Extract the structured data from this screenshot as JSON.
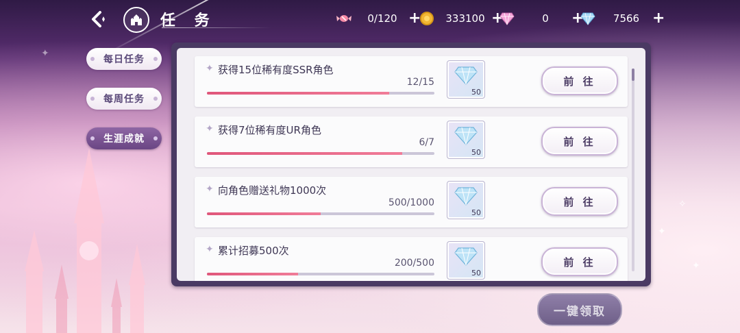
{
  "header": {
    "title": "任 务",
    "back_icon": "back-arrow-icon",
    "home_icon": "castle-icon"
  },
  "resources": [
    {
      "name": "candy",
      "icon": "candy-icon",
      "value": "0/120"
    },
    {
      "name": "coin",
      "icon": "coin-icon",
      "value": "333100"
    },
    {
      "name": "pink-gem",
      "icon": "pink-diamond-icon",
      "value": "0"
    },
    {
      "name": "blue-gem",
      "icon": "blue-diamond-icon",
      "value": "7566"
    }
  ],
  "plus_label": "+",
  "tabs": [
    {
      "label": "每日任务",
      "active": false
    },
    {
      "label": "每周任务",
      "active": false
    },
    {
      "label": "生涯成就",
      "active": true
    }
  ],
  "tasks": [
    {
      "title": "获得15位稀有度SSR角色",
      "progress_text": "12/15",
      "progress": 0.8,
      "reward_icon": "diamond-icon",
      "reward_qty": "50",
      "button": "前 往"
    },
    {
      "title": "获得7位稀有度UR角色",
      "progress_text": "6/7",
      "progress": 0.857,
      "reward_icon": "diamond-icon",
      "reward_qty": "50",
      "button": "前 往"
    },
    {
      "title": "向角色赠送礼物1000次",
      "progress_text": "500/1000",
      "progress": 0.5,
      "reward_icon": "diamond-icon",
      "reward_qty": "50",
      "button": "前 往"
    },
    {
      "title": "累计招募500次",
      "progress_text": "200/500",
      "progress": 0.4,
      "reward_icon": "diamond-icon",
      "reward_qty": "50",
      "button": "前 往"
    }
  ],
  "claim_all": "一键领取",
  "colors": {
    "panel_border": "#4a3a63",
    "progress_fill": "#e0577b",
    "active_tab": "#7a5894"
  }
}
